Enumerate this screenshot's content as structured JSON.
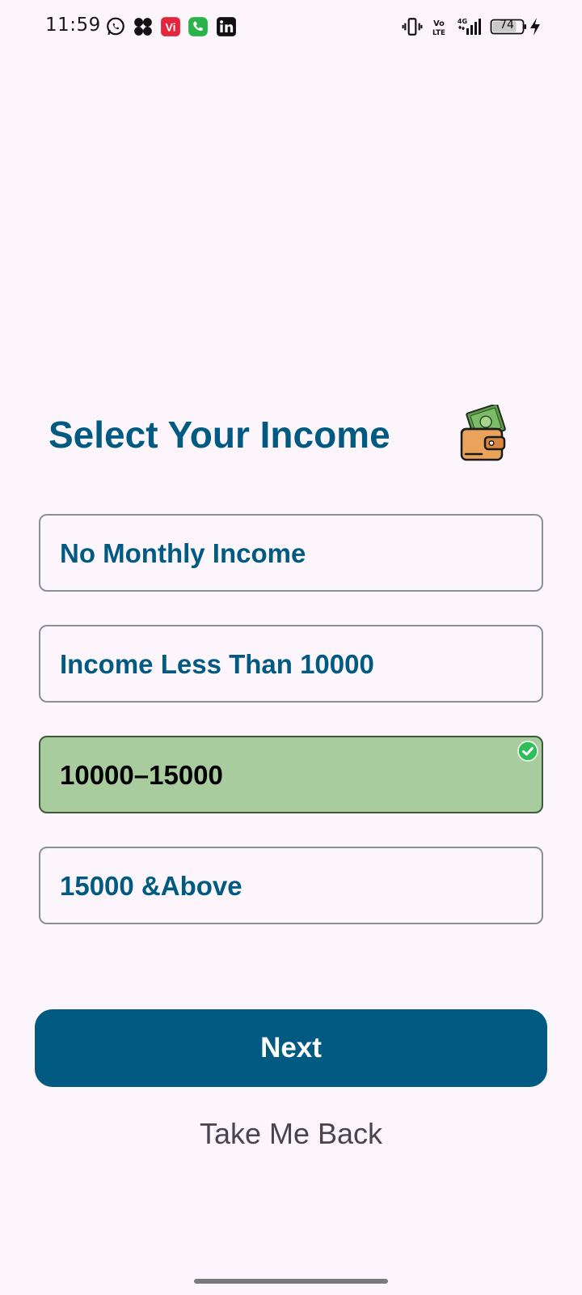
{
  "status_bar": {
    "time": "11:59",
    "notification_icons": [
      "whatsapp-icon",
      "pinwheel-app-icon",
      "vi-app-icon",
      "phone-call-app-icon",
      "linkedin-icon"
    ],
    "system_icons": [
      "vibrate-icon",
      "volte-icon",
      "4g-signal-icon"
    ],
    "battery_level": "74",
    "charging": true
  },
  "screen": {
    "title": "Select Your Income",
    "title_icon": "wallet-money-icon"
  },
  "income_options": [
    {
      "label": "No Monthly Income",
      "selected": false
    },
    {
      "label": "Income Less Than 10000",
      "selected": false
    },
    {
      "label": "10000–15000",
      "selected": true
    },
    {
      "label": "15000 &Above",
      "selected": false
    }
  ],
  "actions": {
    "next_label": "Next",
    "back_label": "Take Me Back"
  },
  "colors": {
    "primary": "#005a82",
    "selected_bg": "#a9cc9f",
    "check_green": "#2fbf5a",
    "background": "#fcf6fc"
  }
}
